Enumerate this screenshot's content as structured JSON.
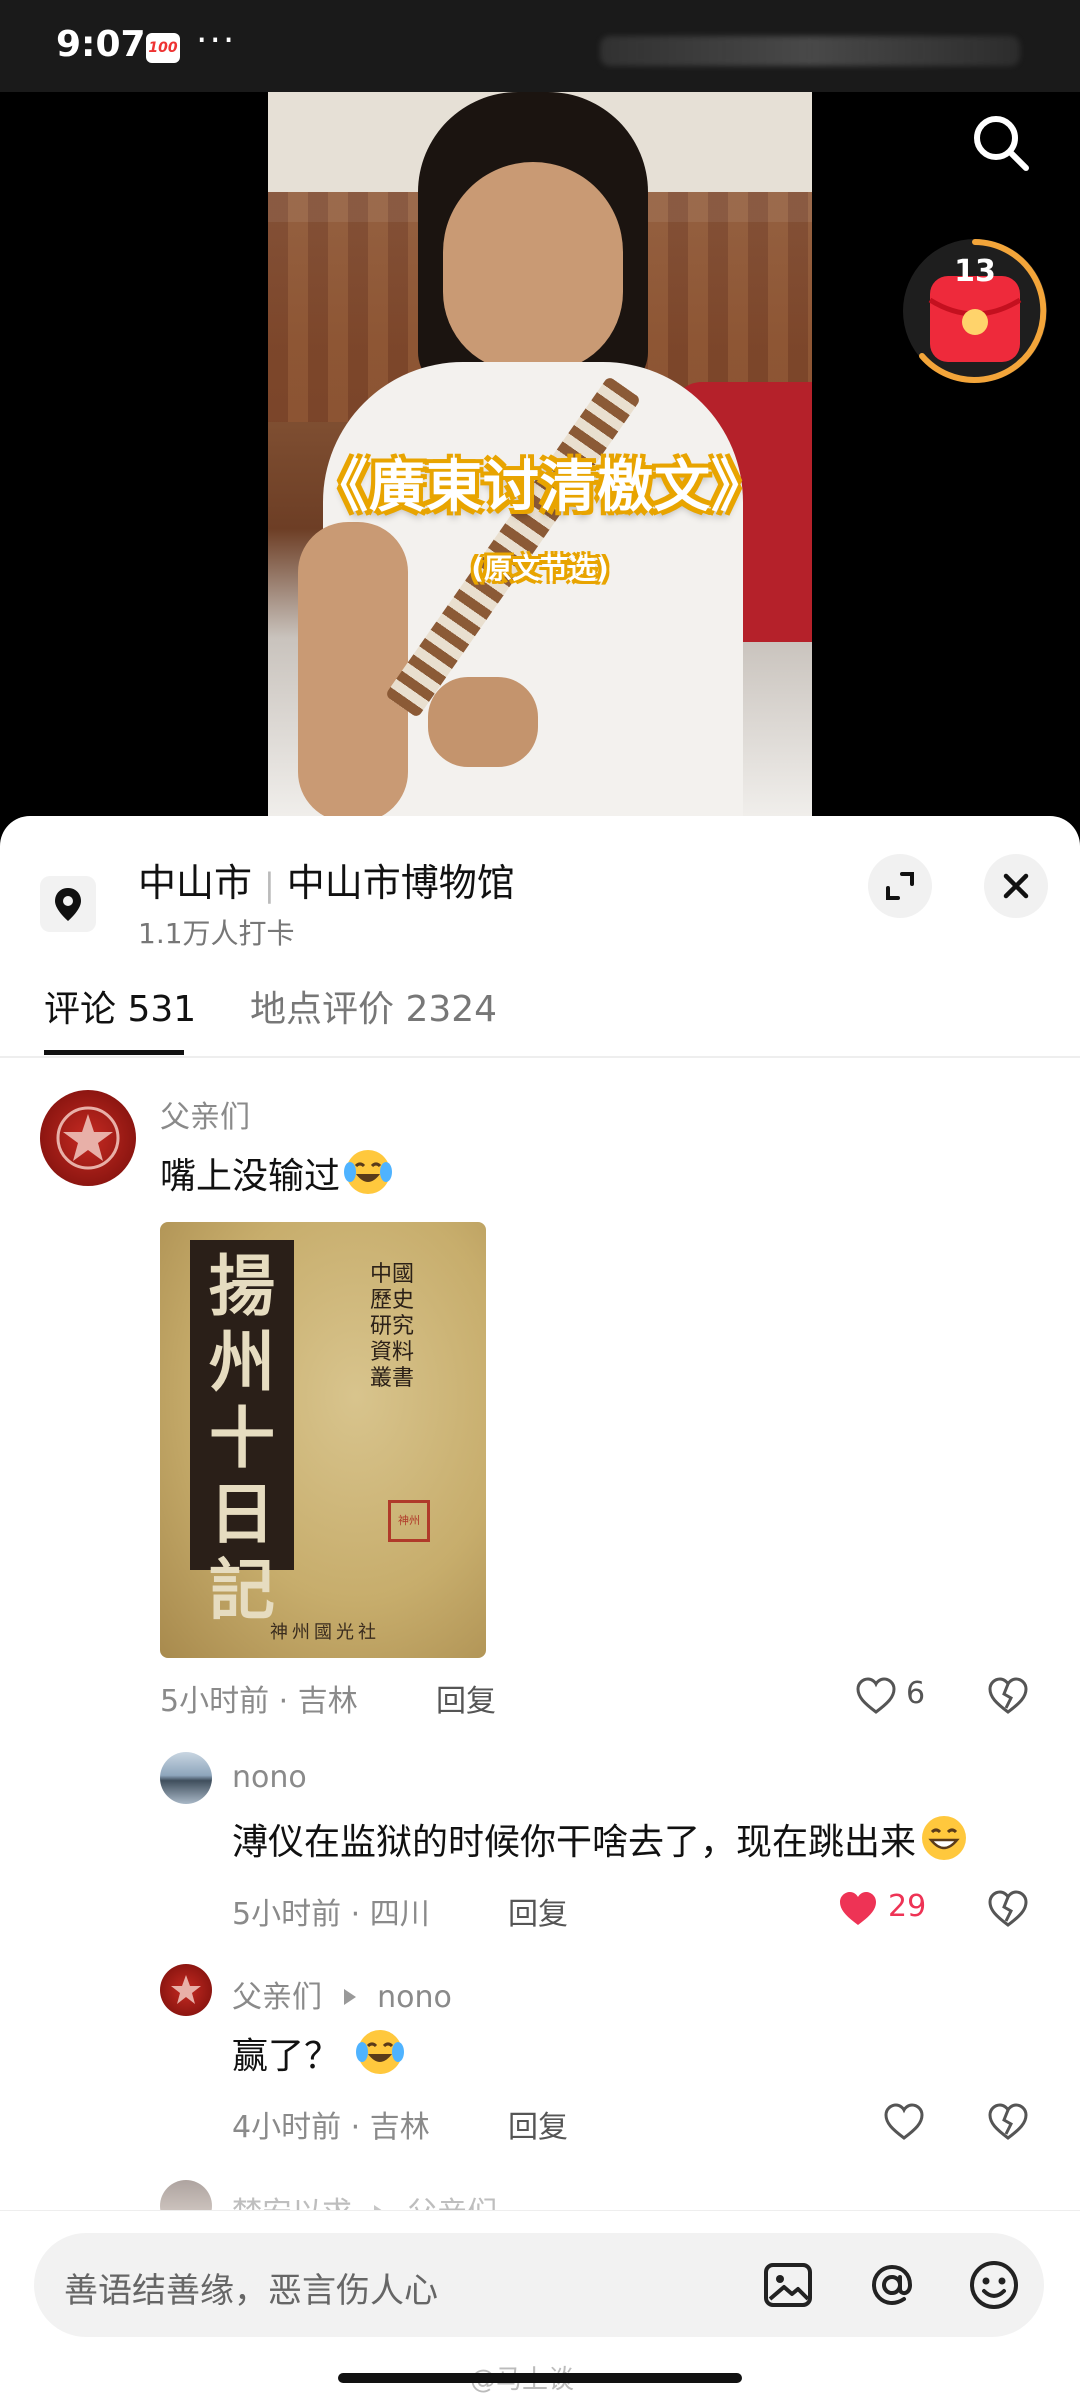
{
  "status_bar": {
    "time": "9:07",
    "app_icon_label": "100",
    "more": "···"
  },
  "video": {
    "title": "《廣東讨清檄文》",
    "subtitle": "(原文节选)",
    "redpacket_count": "13"
  },
  "location": {
    "city": "中山市",
    "place": "中山市博物馆",
    "checkins": "1.1万人打卡"
  },
  "tabs": {
    "comments": "评论 531",
    "reviews": "地点评价 2324"
  },
  "comments": [
    {
      "user": "父亲们",
      "text": "嘴上没输过",
      "time": "5小时前",
      "region": "吉林",
      "reply_label": "回复",
      "likes": "6",
      "liked": false,
      "image": {
        "main_title": "揚州十日記",
        "series": "中國歷史研究資料叢書",
        "publisher": "神州國光社",
        "seal": "神州"
      }
    },
    {
      "user": "nono",
      "text": "溥仪在监狱的时候你干啥去了，现在跳出来",
      "time": "5小时前",
      "region": "四川",
      "reply_label": "回复",
      "likes": "29",
      "liked": true,
      "like_color": "#ee3355"
    },
    {
      "user": "父亲们",
      "reply_to": "nono",
      "text": "赢了？",
      "time": "4小时前",
      "region": "吉林",
      "reply_label": "回复",
      "likes": "",
      "liked": false
    },
    {
      "user": "梦安以求",
      "reply_to": "父亲们"
    }
  ],
  "input": {
    "placeholder": "善语结善缘，恶言伤人心"
  },
  "watermark": "@马上谈",
  "meta_sep": " · "
}
